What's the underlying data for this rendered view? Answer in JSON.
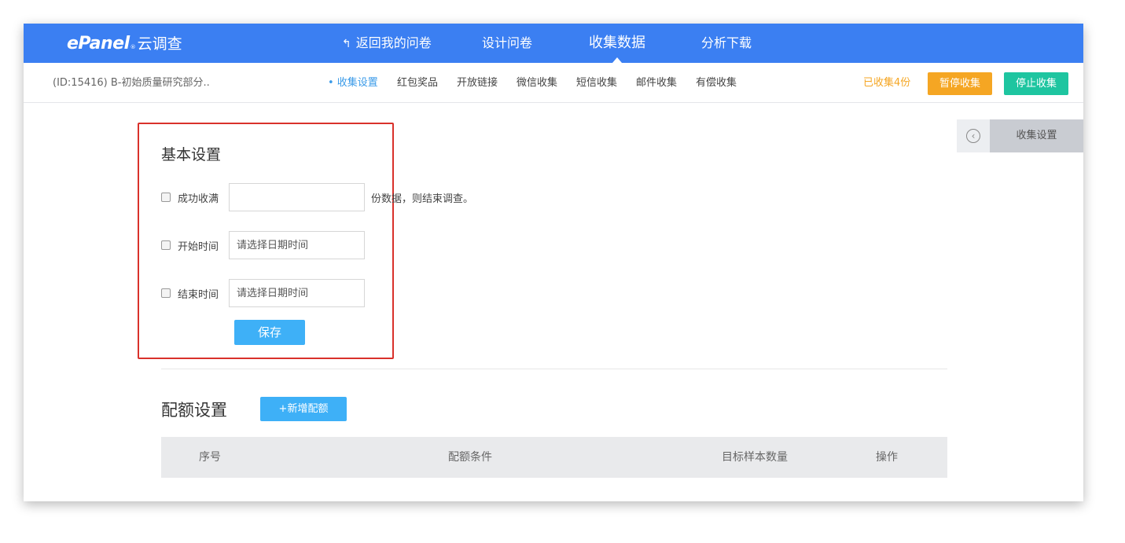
{
  "brand": {
    "logo_text": "ePanel",
    "logo_mark": "®",
    "logo_cn": "云调查"
  },
  "topnav": [
    {
      "label": "返回我的问卷",
      "icon": "back-arrow-icon"
    },
    {
      "label": "设计问卷"
    },
    {
      "label": "收集数据",
      "active": true
    },
    {
      "label": "分析下载"
    }
  ],
  "survey": {
    "id_label": "(ID:15416) B-初始质量研究部分.."
  },
  "subnav": [
    {
      "label": "• 收集设置",
      "active": true
    },
    {
      "label": "红包奖品"
    },
    {
      "label": "开放链接"
    },
    {
      "label": "微信收集"
    },
    {
      "label": "短信收集"
    },
    {
      "label": "邮件收集"
    },
    {
      "label": "有偿收集"
    }
  ],
  "status": {
    "collected": "已收集4份",
    "pause_label": "暂停收集",
    "stop_label": "停止收集"
  },
  "basic": {
    "title": "基本设置",
    "quota_label": "成功收满",
    "quota_value": "",
    "quota_suffix": "份数据，则结束调查。",
    "start_label": "开始时间",
    "start_placeholder": "请选择日期时间",
    "end_label": "结束时间",
    "end_placeholder": "请选择日期时间",
    "save_label": "保存"
  },
  "quota": {
    "title": "配额设置",
    "add_label": "+新增配额",
    "columns": [
      "序号",
      "配额条件",
      "目标样本数量",
      "操作"
    ]
  },
  "side_panel": {
    "label": "收集设置",
    "icon": "chevron-left-circle-icon"
  },
  "colors": {
    "primary": "#3b7ff2",
    "pause": "#f5a623",
    "stop": "#1ec5a0",
    "button": "#3eb0f7",
    "highlight": "#d9312b"
  }
}
